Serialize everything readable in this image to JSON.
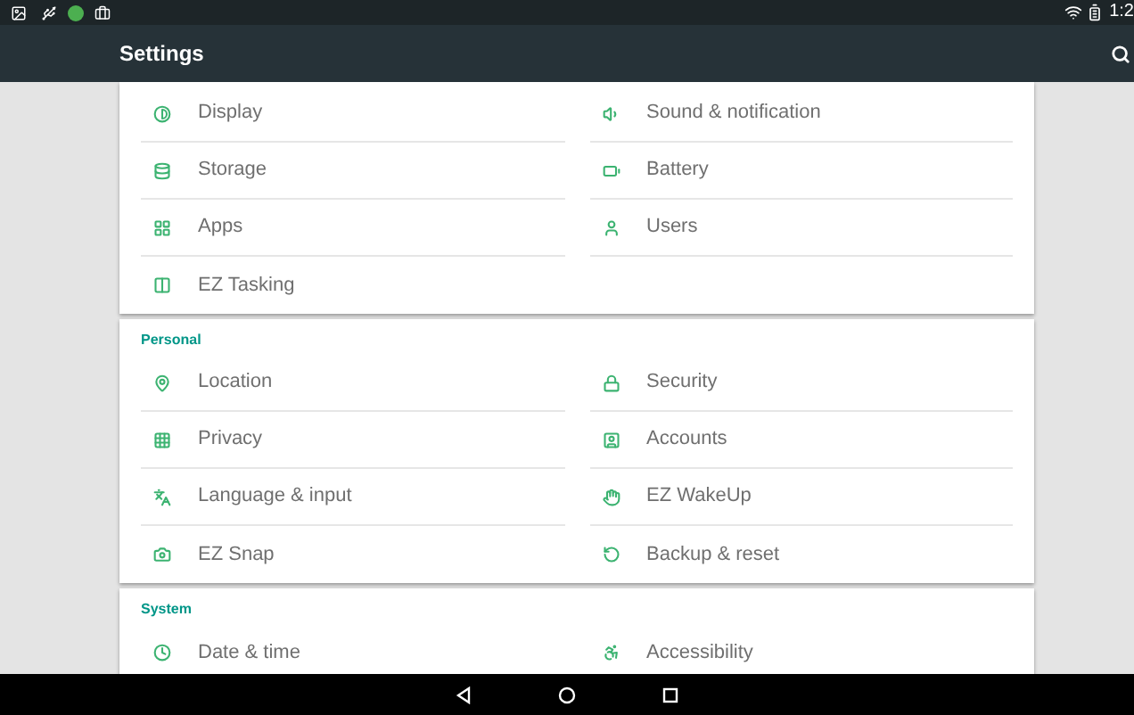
{
  "status_bar": {
    "time": "1:2"
  },
  "app_bar": {
    "title": "Settings"
  },
  "sections": [
    {
      "items": [
        "Display",
        "Sound & notification",
        "Storage",
        "Battery",
        "Apps",
        "Users",
        "EZ Tasking"
      ]
    },
    {
      "header": "Personal",
      "items": [
        "Location",
        "Security",
        "Privacy",
        "Accounts",
        "Language & input",
        "EZ WakeUp",
        "EZ Snap",
        "Backup & reset"
      ]
    },
    {
      "header": "System",
      "items": [
        "Date & time",
        "Accessibility"
      ]
    }
  ]
}
